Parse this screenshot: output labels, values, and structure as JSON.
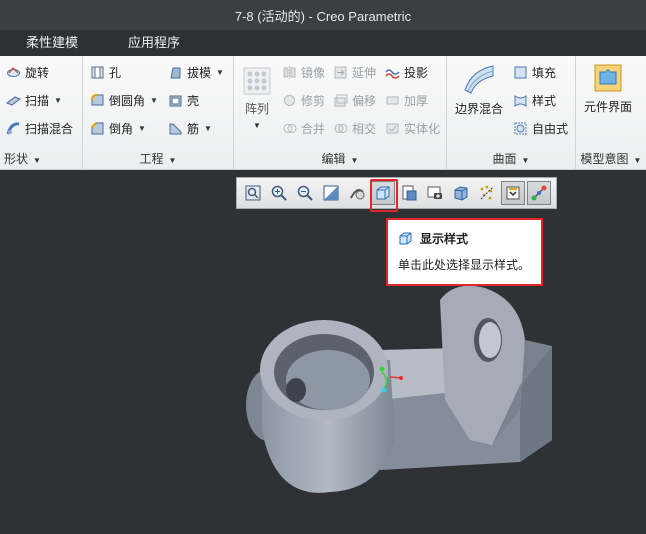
{
  "window": {
    "title": "7-8 (活动的) - Creo Parametric"
  },
  "menu_tabs": [
    {
      "label": "柔性建模"
    },
    {
      "label": "应用程序"
    }
  ],
  "ribbon": {
    "shape": {
      "label": "形状",
      "items": [
        {
          "label": "旋转",
          "icon": "revolve-icon"
        },
        {
          "label": "扫描",
          "icon": "sweep-icon"
        },
        {
          "label": "扫描混合",
          "icon": "swept-blend-icon"
        }
      ]
    },
    "engineering": {
      "label": "工程",
      "items": [
        {
          "label": "孔",
          "icon": "hole-icon"
        },
        {
          "label": "拔模",
          "icon": "draft-icon"
        },
        {
          "label": "倒圆角",
          "icon": "round-icon"
        },
        {
          "label": "壳",
          "icon": "shell-icon"
        },
        {
          "label": "倒角",
          "icon": "chamfer-icon"
        },
        {
          "label": "筋",
          "icon": "rib-icon"
        }
      ]
    },
    "editing": {
      "label": "编辑",
      "pattern_label": "阵列",
      "items": [
        {
          "label": "镜像"
        },
        {
          "label": "延伸"
        },
        {
          "label": "投影"
        },
        {
          "label": "修剪"
        },
        {
          "label": "偏移"
        },
        {
          "label": "加厚"
        },
        {
          "label": "合并"
        },
        {
          "label": "相交"
        },
        {
          "label": "实体化"
        }
      ]
    },
    "surfaces": {
      "label": "曲面",
      "boundary_blend_label": "边界混合",
      "items": [
        {
          "label": "填充"
        },
        {
          "label": "样式"
        },
        {
          "label": "自由式"
        }
      ]
    },
    "model_intent": {
      "label": "模型意图",
      "component_interface_label": "元件界面"
    }
  },
  "graphics_toolbar": {
    "buttons": [
      "refit-icon",
      "zoom-in-icon",
      "zoom-out-icon",
      "repaint-icon",
      "spin-center-icon",
      "display-style-icon",
      "saved-orientations-icon",
      "view-manager-icon",
      "perspective-icon",
      "datum-display-icon",
      "annotation-display-icon",
      "spin-toggle-icon"
    ]
  },
  "tooltip": {
    "title": "显示样式",
    "description": "单击此处选择显示样式。"
  },
  "colors": {
    "highlight": "#e0262b",
    "model_fill": "#aab1bd",
    "viewport_bg": "#2e3235"
  }
}
